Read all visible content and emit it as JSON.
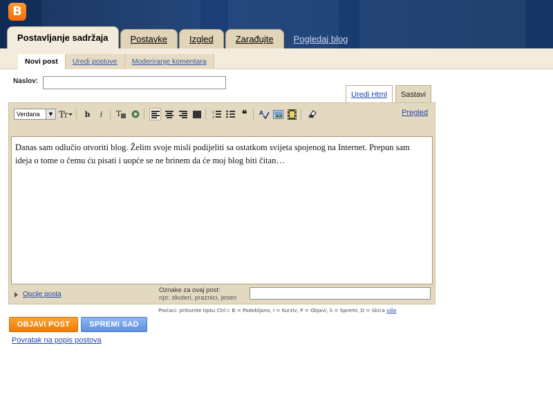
{
  "header": {
    "logo_letter": "B",
    "tabs": [
      {
        "label": "Postavljanje sadržaja",
        "active": true
      },
      {
        "label": "Postavke",
        "active": false
      },
      {
        "label": "Izgled",
        "active": false
      },
      {
        "label": "Zarađujte",
        "active": false
      }
    ],
    "view_blog_link": "Pogledaj blog"
  },
  "subnav": {
    "items": [
      {
        "label": "Novi post",
        "active": true
      },
      {
        "label": "Uredi postove",
        "active": false
      },
      {
        "label": "Moderiranje komentara",
        "active": false
      }
    ]
  },
  "post": {
    "title_label": "Naslov:",
    "title_value": "",
    "mode_tabs": [
      {
        "label": "Uredi Html",
        "active": false
      },
      {
        "label": "Sastavi",
        "active": true
      }
    ],
    "toolbar": {
      "font_value": "Verdana",
      "preview_label": "Pregled",
      "icons": [
        "font-size-icon",
        "bold-icon",
        "italic-icon",
        "text-color-icon",
        "link-icon",
        "align-left-icon",
        "align-center-icon",
        "align-right-icon",
        "justify-icon",
        "numbered-list-icon",
        "bullet-list-icon",
        "quote-icon",
        "spellcheck-icon",
        "image-icon",
        "video-icon",
        "remove-format-icon"
      ]
    },
    "body_text": "Danas sam odlučio otvoriti blog. Želim svoje misli podijeliti sa ostatkom svijeta spojenog na Internet. Prepun sam ideja o tome o čemu ću pisati i uopće se ne brinem da će moj blog biti čitan…",
    "options_link": "Opcije posta",
    "tags_label": "Oznake za ovaj post:",
    "tags_hint": "npr. skuteri, praznici, jesen",
    "tags_value": ""
  },
  "shortcuts": {
    "text": "Prečaci: pritisnite tipku Ctrl i: B = Podebljano, I = Kurziv, P = Objavi, S = Spremi, D = Skica",
    "more_link": "više"
  },
  "actions": {
    "publish_label": "OBJAVI POST",
    "save_label": "SPREMI SAD",
    "back_link": "Povratak na popis postova"
  },
  "colors": {
    "header_bg": "#1b3f78",
    "tab_bg": "#e1d4b7",
    "editor_bg": "#e3d9c1",
    "publish_button": "#ef7d00",
    "save_button": "#5d8fe0",
    "link": "#2244aa"
  }
}
